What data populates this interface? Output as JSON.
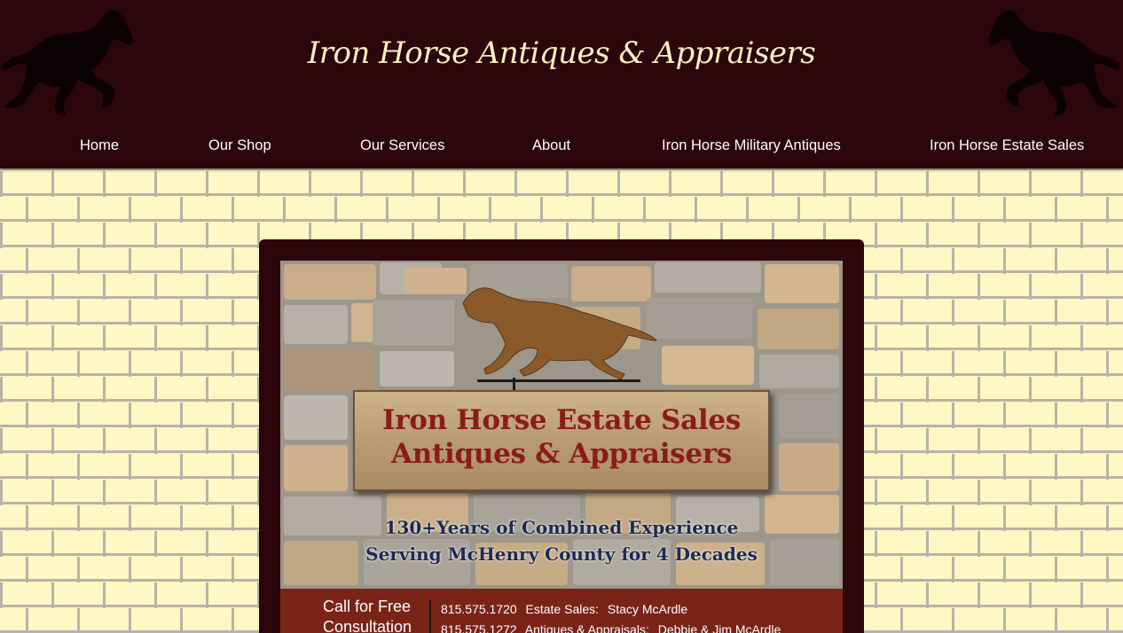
{
  "site": {
    "title": "Iron Horse Antiques & Appraisers"
  },
  "nav": {
    "items": [
      {
        "label": "Home"
      },
      {
        "label": "Our Shop"
      },
      {
        "label": "Our Services"
      },
      {
        "label": "About"
      },
      {
        "label": "Iron Horse Military Antiques"
      },
      {
        "label": "Iron Horse Estate Sales"
      }
    ]
  },
  "feature": {
    "sign_line1": "Iron Horse Estate Sales",
    "sign_line2": "Antiques & Appraisers",
    "tagline1": "130+Years of Combined Experience",
    "tagline2": "Serving McHenry County for 4 Decades",
    "cta_line1": "Call for Free",
    "cta_line2": "Consultation",
    "contacts": [
      {
        "phone": "815.575.1720",
        "role": "Estate Sales:",
        "names": "Stacy McArdle"
      },
      {
        "phone": "815.575.1272",
        "role": "Antiques & Appraisals:",
        "names": "Debbie & Jim McArdle"
      }
    ]
  },
  "icons": {
    "left_horse": "running-horse-silhouette-icon",
    "right_horse": "running-horse-silhouette-icon",
    "weathervane": "horse-weathervane-icon"
  },
  "colors": {
    "header_bg": "#2b060b",
    "title_text": "#fbf0c4",
    "brick_face": "#fdf8c4",
    "brick_mortar": "#b8b3a8",
    "sign_text": "#8b1d17",
    "tagline_text": "#1c2a55",
    "ad_band": "#7a2418"
  }
}
